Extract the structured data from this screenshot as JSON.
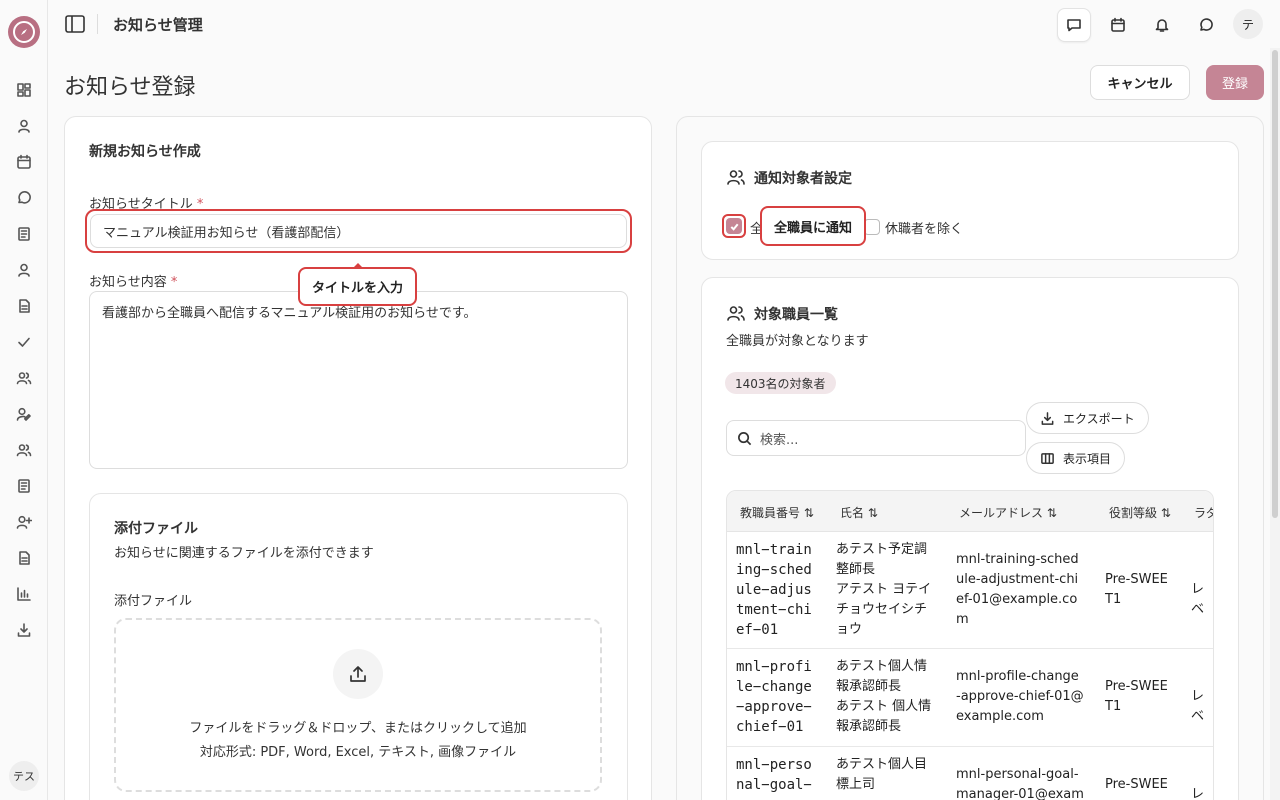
{
  "app": {
    "title": "お知らせ管理",
    "user_initial": "テ",
    "sidebar_user": "テス"
  },
  "page": {
    "title": "お知らせ登録",
    "cancel_label": "キャンセル",
    "submit_label": "登録"
  },
  "form": {
    "section_title": "新規お知らせ作成",
    "title_label": "お知らせタイトル",
    "title_value": "マニュアル検証用お知らせ（看護部配信）",
    "content_label": "お知らせ内容",
    "content_value": "看護部から全職員へ配信するマニュアル検証用のお知らせです。",
    "required_mark": "*",
    "title_tooltip": "タイトルを入力"
  },
  "attachments": {
    "title": "添付ファイル",
    "description": "お知らせに関連するファイルを添付できます",
    "field_label": "添付ファイル",
    "drop_text": "ファイルをドラッグ＆ドロップ、またはクリックして追加",
    "formats_text": "対応形式: PDF, Word, Excel, テキスト, 画像ファイル"
  },
  "target_settings": {
    "title": "通知対象者設定",
    "notify_all_label": "全",
    "notify_all_checked": true,
    "notify_all_tooltip": "全職員に通知",
    "exclude_leave_label": "休職者を除く",
    "exclude_leave_checked": false
  },
  "staff_list": {
    "title": "対象職員一覧",
    "description": "全職員が対象となります",
    "count_badge": "1403名の対象者",
    "search_placeholder": "検索...",
    "export_label": "エクスポート",
    "columns_label": "表示項目",
    "headers": [
      "教職員番号 ⇅",
      "氏名 ⇅",
      "メールアドレス ⇅",
      "役割等級 ⇅",
      "ラダ"
    ],
    "rows": [
      {
        "id": [
          "mnl−train",
          "ing−sched",
          "ule−adjus",
          "tment−chi",
          "ef−01"
        ],
        "name": [
          "あテスト予定調",
          "整師長",
          "アテスト ヨテイ",
          "チョウセイシチ",
          "ョウ"
        ],
        "email": [
          "mnl-training-sched",
          "ule-adjustment-chi",
          "ef-01@example.co",
          "m"
        ],
        "role": [
          "Pre-SWEE",
          "T1"
        ],
        "ladder": "レベ"
      },
      {
        "id": [
          "mnl−profi",
          "le−change",
          "−approve−",
          "chief−01"
        ],
        "name": [
          "あテスト個人情",
          "報承認師長",
          "あテスト 個人情",
          "報承認師長"
        ],
        "email": [
          "mnl-profile-change",
          "-approve-chief-01@",
          "example.com"
        ],
        "role": [
          "Pre-SWEE",
          "T1"
        ],
        "ladder": "レベ"
      },
      {
        "id": [
          "mnl−perso",
          "nal−goal−"
        ],
        "name": [
          "あテスト個人目",
          "標上司"
        ],
        "email": [
          "mnl-personal-goal-",
          "manager-01@exam"
        ],
        "role": [
          "Pre-SWEE"
        ],
        "ladder": "レベ"
      }
    ]
  },
  "colors": {
    "accent": "#c58595",
    "highlight": "#d84040"
  }
}
